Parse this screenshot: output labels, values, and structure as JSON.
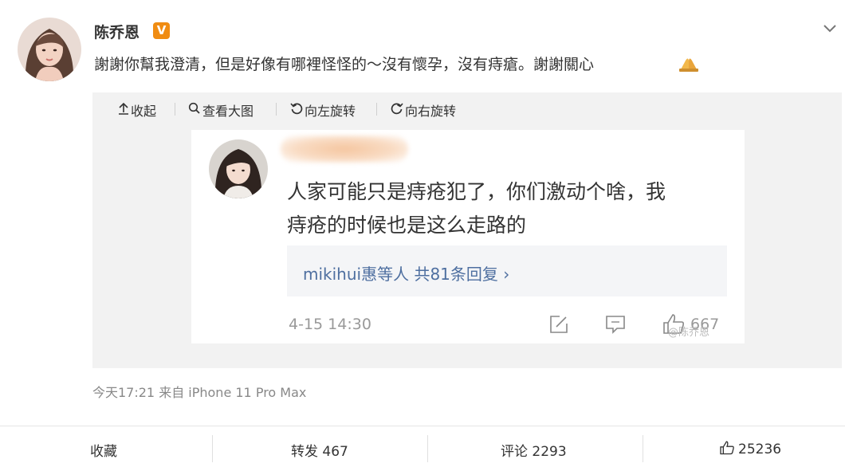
{
  "post": {
    "author": "陈乔恩",
    "verified_badge": "V",
    "text": "謝謝你幫我澄清，但是好像有哪裡怪怪的～沒有懷孕，沒有痔瘡。謝謝關心",
    "meta": "今天17:21 来自 iPhone 11 Pro Max"
  },
  "media_toolbar": {
    "collapse": "收起",
    "view_large": "查看大图",
    "rotate_left": "向左旋转",
    "rotate_right": "向右旋转"
  },
  "embedded_comment": {
    "text_line1": "人家可能只是痔疮犯了，你们激动个啥，我",
    "text_line2": "痔疮的时候也是这么走路的",
    "replies": "mikihui惠等人  共81条回复 ›",
    "time": "4-15 14:30",
    "likes": "667",
    "watermark": "@陈乔恩"
  },
  "actions": {
    "favorite": "收藏",
    "repost": "转发 467",
    "comment": "评论 2293",
    "like": "25236"
  },
  "icons": [
    "chevron-down-icon",
    "collapse-icon",
    "search-icon",
    "rotate-left-icon",
    "rotate-right-icon",
    "edit-icon",
    "comment-icon",
    "thumbs-up-icon",
    "praying-hands-emoji"
  ],
  "colors": {
    "badge": "#f08c12",
    "link": "#4e6fa0",
    "media_bg": "#f2f2f2"
  }
}
